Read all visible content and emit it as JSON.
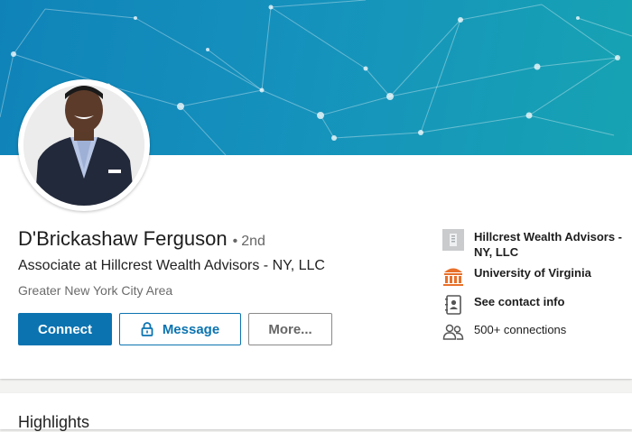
{
  "profile": {
    "name": "D'Brickashaw Ferguson",
    "degree": "2nd",
    "headline": "Associate at Hillcrest Wealth Advisors - NY, LLC",
    "location": "Greater New York City Area"
  },
  "actions": {
    "connect_label": "Connect",
    "message_label": "Message",
    "more_label": "More..."
  },
  "sidebar": {
    "company": "Hillcrest Wealth Advisors - NY, LLC",
    "school": "University of Virginia",
    "contact": "See contact info",
    "connections": "500+ connections"
  },
  "section2": {
    "title": "Highlights"
  },
  "colors": {
    "accent": "#0b73b0",
    "banner_start": "#0f83b8",
    "banner_end": "#17a3b3",
    "school_orange": "#e8702a"
  },
  "icons": {
    "company": "building-icon",
    "school": "university-icon",
    "contact": "contact-card-icon",
    "connections": "people-icon",
    "message": "lock-icon"
  }
}
